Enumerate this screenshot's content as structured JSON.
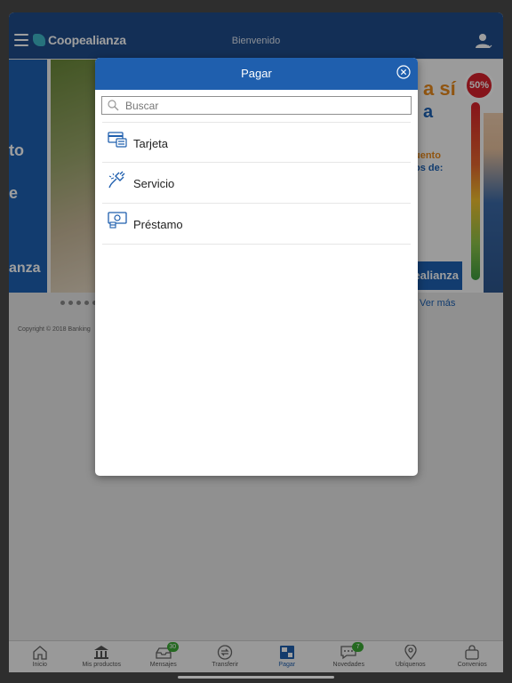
{
  "header": {
    "brand": "Coopealianza",
    "title": "Bienvenido"
  },
  "banner": {
    "left_lines": [
      "to",
      "e",
      "anza"
    ],
    "right_heading_1": "a sí",
    "right_heading_2": "a",
    "right_body_1": "uento",
    "right_body_2": "os de:",
    "badge": "50%",
    "strip": "ealianza"
  },
  "below": {
    "ver_mas": "Ver más",
    "copyright": "Copyright © 2018 Banking"
  },
  "modal": {
    "title": "Pagar",
    "search_placeholder": "Buscar",
    "items": [
      {
        "label": "Tarjeta",
        "icon": "card-icon"
      },
      {
        "label": "Servicio",
        "icon": "plug-icon"
      },
      {
        "label": "Préstamo",
        "icon": "loan-icon"
      }
    ]
  },
  "tabs": [
    {
      "label": "Inicio",
      "icon": "home-icon"
    },
    {
      "label": "Mis productos",
      "icon": "bank-icon"
    },
    {
      "label": "Mensajes",
      "icon": "inbox-icon",
      "badge": "30"
    },
    {
      "label": "Transferir",
      "icon": "transfer-icon"
    },
    {
      "label": "Pagar",
      "icon": "pay-icon",
      "active": true
    },
    {
      "label": "Novedades",
      "icon": "chat-icon",
      "badge": "7"
    },
    {
      "label": "Ubíquenos",
      "icon": "location-icon"
    },
    {
      "label": "Convenios",
      "icon": "bag-icon"
    }
  ],
  "colors": {
    "header": "#1f4d8c",
    "modal_header": "#1f5fae",
    "accent": "#1d62b3",
    "badge": "#3aaa35"
  }
}
